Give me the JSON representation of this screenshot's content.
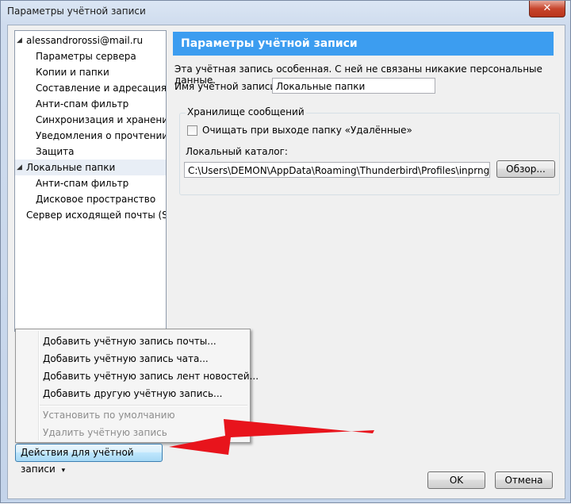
{
  "window": {
    "title": "Параметры учётной записи",
    "close_label": "✕"
  },
  "tree": {
    "items": [
      {
        "label": "alessandrorossi@mail.ru",
        "twisty": "◢"
      },
      {
        "label": "Параметры сервера"
      },
      {
        "label": "Копии и папки"
      },
      {
        "label": "Составление и адресация"
      },
      {
        "label": "Анти-спам фильтр"
      },
      {
        "label": "Синхронизация и хранение"
      },
      {
        "label": "Уведомления о прочтении"
      },
      {
        "label": "Защита"
      },
      {
        "label": "Локальные папки",
        "twisty": "◢"
      },
      {
        "label": "Анти-спам фильтр"
      },
      {
        "label": "Дисковое пространство"
      },
      {
        "label": "Сервер исходящей почты (S..."
      }
    ]
  },
  "panel": {
    "header": "Параметры учётной записи",
    "description": "Эта учётная запись особенная. С ней не связаны никакие персональные данные.",
    "account_name_label": "Имя учётной записи:",
    "account_name_value": "Локальные папки",
    "storage_group_title": "Хранилище сообщений",
    "empty_trash_label": "Очищать при выходе папку «Удалённые»",
    "local_dir_label": "Локальный каталог:",
    "local_dir_value": "C:\\Users\\DEMON\\AppData\\Roaming\\Thunderbird\\Profiles\\inprngmj.de",
    "browse_label": "Обзор..."
  },
  "menu": {
    "items": [
      {
        "label": "Добавить учётную запись почты...",
        "enabled": true
      },
      {
        "label": "Добавить учётную запись чата...",
        "enabled": true
      },
      {
        "label": "Добавить учётную запись лент новостей...",
        "enabled": true
      },
      {
        "label": "Добавить другую учётную запись...",
        "enabled": true
      },
      {
        "label": "Установить по умолчанию",
        "enabled": false
      },
      {
        "label": "Удалить учётную запись",
        "enabled": false
      }
    ]
  },
  "actions_button": {
    "label": "Действия для учётной записи",
    "caret": "▾"
  },
  "footer": {
    "ok_label": "OK",
    "cancel_label": "Отмена"
  },
  "colors": {
    "header_bg": "#3c9df0",
    "arrow": "#e8141c",
    "selection": "#e8eef6"
  }
}
